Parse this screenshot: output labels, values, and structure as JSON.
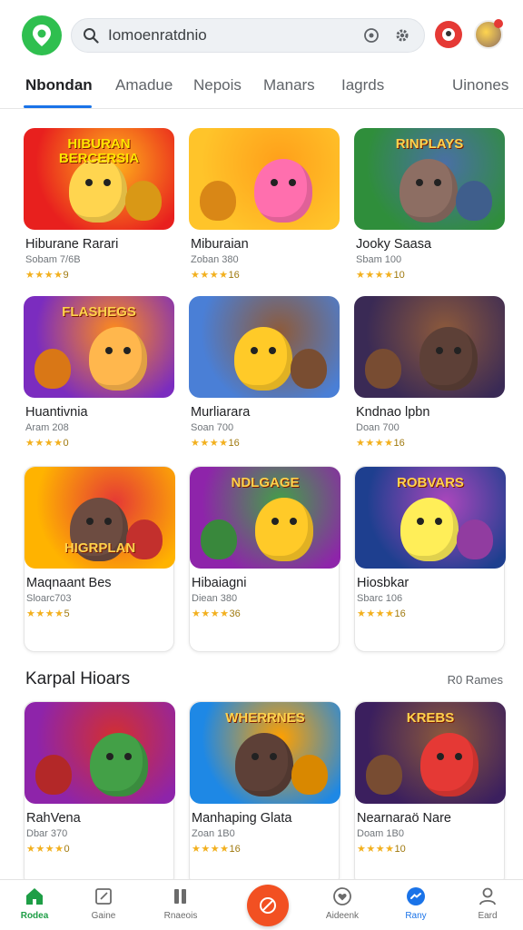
{
  "search": {
    "text": "Iomoenratdnio"
  },
  "tabs": [
    {
      "label": "Nbondan"
    },
    {
      "label": "Amadue"
    },
    {
      "label": "Nepois"
    },
    {
      "label": "Manars"
    },
    {
      "label": "Iagrds"
    },
    {
      "label": "Uinones"
    }
  ],
  "cards": [
    {
      "title": "Hiburane Rarari",
      "sub": "Sobam 7/6B",
      "rating": "9",
      "banner": "HIBURAN\nBERCERSIA"
    },
    {
      "title": "Miburaian",
      "sub": "Zoban 380",
      "rating": "16",
      "banner": ""
    },
    {
      "title": "Jooky Saasa",
      "sub": "Sbam 100",
      "rating": "10",
      "banner": "RINPLAYS"
    },
    {
      "title": "Huantivnia",
      "sub": "Aram 208",
      "rating": "0",
      "banner": "FLASHEGS"
    },
    {
      "title": "Murliarara",
      "sub": "Soan 700",
      "rating": "16",
      "banner": ""
    },
    {
      "title": "Kndnao lpbn",
      "sub": "Doan 700",
      "rating": "16",
      "banner": ""
    },
    {
      "title": "Maqnaant Bes",
      "sub": "Sloarc703",
      "rating": "5",
      "banner": "HIGRPLAN"
    },
    {
      "title": "Hibaiagni",
      "sub": "Diean 380",
      "rating": "36",
      "banner": "NDLGAGE"
    },
    {
      "title": "Hiosbkar",
      "sub": "Sbarc 106",
      "rating": "16",
      "banner": "ROBVARS"
    },
    {
      "title": "RahVena",
      "sub": "Dbar 370",
      "rating": "0",
      "banner": ""
    },
    {
      "title": "Manhaping Glata",
      "sub": "Zoan 1B0",
      "rating": "16",
      "banner": "WHERRNES"
    },
    {
      "title": "Nearnaraö Nare",
      "sub": "Doam 1B0",
      "rating": "10",
      "banner": "KREBS"
    }
  ],
  "section": {
    "title": "Karpal Hioars",
    "more": "R0 Rames"
  },
  "nav": [
    {
      "label": "Rodea",
      "icon": "home-icon"
    },
    {
      "label": "Gaine",
      "icon": "edit-icon"
    },
    {
      "label": "Rnaeois",
      "icon": "library-icon"
    },
    {
      "label": "",
      "icon": "no-pencil-icon"
    },
    {
      "label": "Aideenk",
      "icon": "heart-icon"
    },
    {
      "label": "Rany",
      "icon": "chat-icon"
    },
    {
      "label": "Eard",
      "icon": "profile-icon"
    }
  ],
  "colors": {
    "accent": "#1a73e8",
    "brand_green": "#2fbf4f",
    "star": "#f2b01e",
    "fab": "#f25022"
  }
}
